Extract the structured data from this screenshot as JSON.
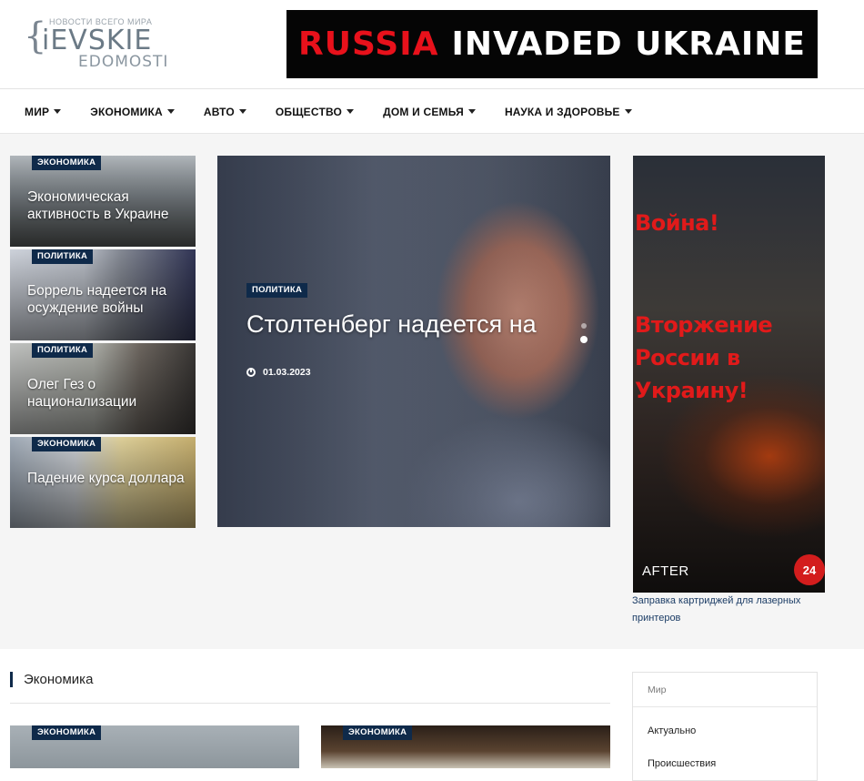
{
  "logo": {
    "tagline": "НОВОСТИ ВСЕГО МИРА",
    "line1": "iEVSKIE",
    "line2": "EDOMOSTI"
  },
  "banner": {
    "red": "RUSSIA",
    "white": "INVADED UKRAINE"
  },
  "nav": [
    "МИР",
    "ЭКОНОМИКА",
    "АВТО",
    "ОБЩЕСТВО",
    "ДОМ И СЕМЬЯ",
    "НАУКА И ЗДОРОВЬЕ"
  ],
  "side_posts": [
    {
      "category": "ЭКОНОМИКА",
      "title": "Экономическая активность в Украине"
    },
    {
      "category": "ПОЛИТИКА",
      "title": "Боррель надеется на осуждение войны"
    },
    {
      "category": "ПОЛИТИКА",
      "title": "Олег Гез о национализации"
    },
    {
      "category": "ЭКОНОМИКА",
      "title": "Падение курса доллара"
    }
  ],
  "featured": {
    "category": "ПОЛИТИКА",
    "title": "Столтенберг надеется на",
    "date": "01.03.2023"
  },
  "ad": {
    "line1": "Война!",
    "line2": "Вторжение",
    "line3": "России в",
    "line4": "Украину!",
    "after": "AFTER",
    "channel": "24",
    "caption": "Заправка картриджей для лазерных принтеров"
  },
  "section": {
    "title": "Экономика"
  },
  "tiles": [
    {
      "category": "ЭКОНОМИКА"
    },
    {
      "category": "ЭКОНОМИКА"
    }
  ],
  "widget": {
    "title": "Мир",
    "items": [
      "Актуально",
      "Происшествия"
    ]
  }
}
